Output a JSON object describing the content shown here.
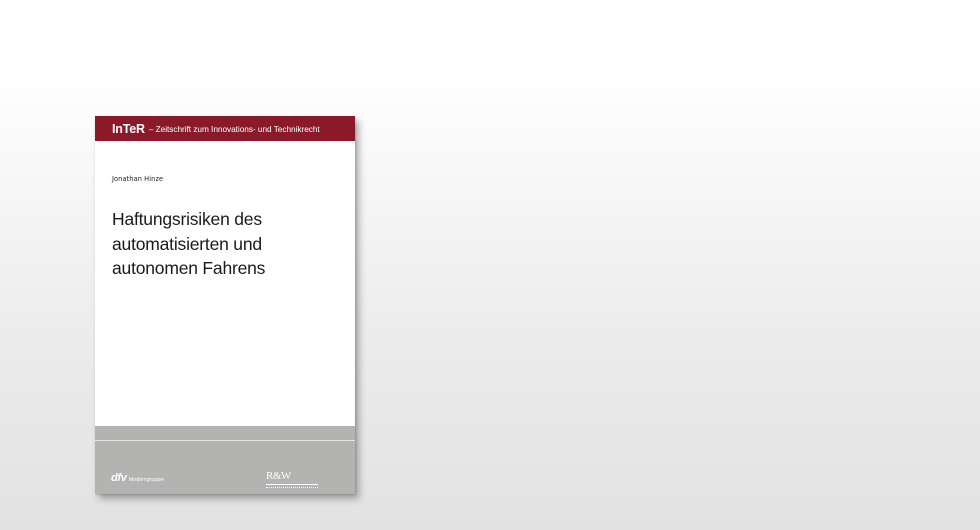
{
  "book": {
    "series_logo": "InTeR",
    "series_desc": "– Zeitschrift zum Innovations- und Technikrecht",
    "author": "Jonathan Hinze",
    "title_lines": [
      "Haftungsrisiken des",
      "automatisierten und",
      "autonomen Fahrens"
    ],
    "publisher": {
      "mark": "dfv",
      "sub": "Mediengruppe"
    },
    "imprint": {
      "mark": "R&W"
    },
    "colors": {
      "band": "#8a1a2a",
      "footer": "#b3b3b2"
    }
  }
}
